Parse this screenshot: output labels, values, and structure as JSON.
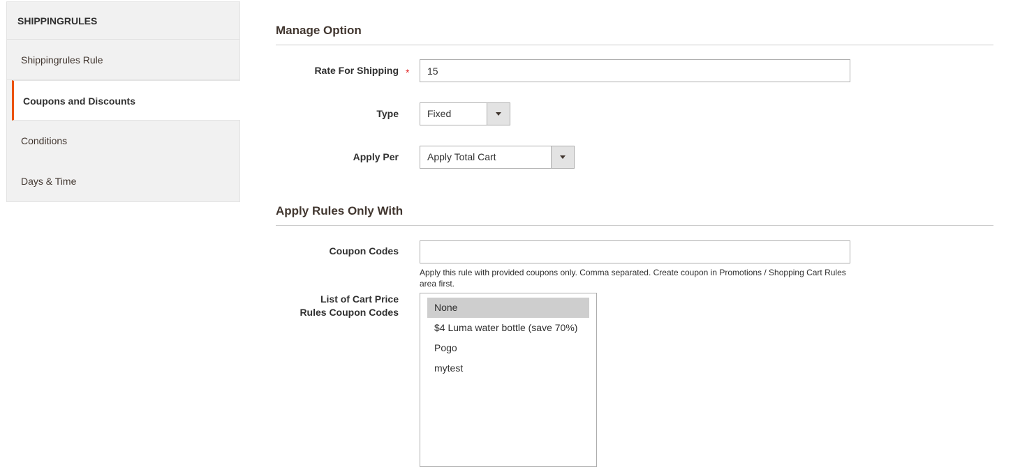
{
  "sidebar": {
    "title": "SHIPPINGRULES",
    "items": [
      {
        "label": "Shippingrules Rule"
      },
      {
        "label": "Coupons and Discounts"
      },
      {
        "label": "Conditions"
      },
      {
        "label": "Days & Time"
      }
    ]
  },
  "manage_option": {
    "title": "Manage Option",
    "rate_label": "Rate For Shipping",
    "rate_required": "*",
    "rate_value": "15",
    "type_label": "Type",
    "type_value": "Fixed",
    "apply_per_label": "Apply Per",
    "apply_per_value": "Apply Total Cart"
  },
  "apply_rules": {
    "title": "Apply Rules Only With",
    "coupon_codes_label": "Coupon Codes",
    "coupon_codes_value": "",
    "coupon_note": "Apply this rule with provided coupons only. Comma separated. Create coupon in Promotions / Shopping Cart Rules area first.",
    "list_label_line1": "List of Cart Price",
    "list_label_line2": "Rules Coupon Codes",
    "options": [
      {
        "label": "None",
        "selected": true
      },
      {
        "label": "$4 Luma water bottle (save 70%)",
        "selected": false
      },
      {
        "label": "Pogo",
        "selected": false
      },
      {
        "label": "mytest",
        "selected": false
      }
    ]
  }
}
